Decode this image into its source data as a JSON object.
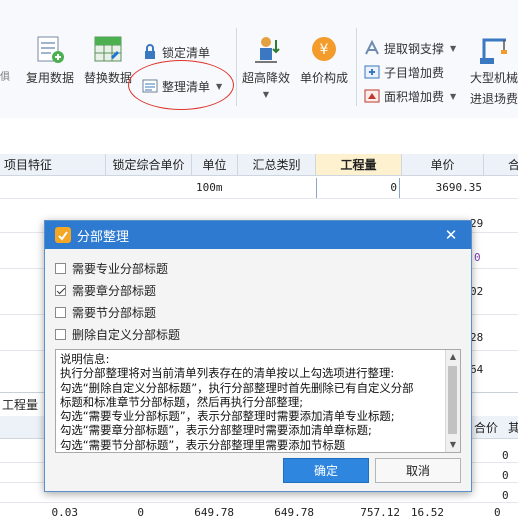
{
  "ribbon": {
    "reuse_label": "复用数据",
    "replace_label": "替换数据",
    "lock_label": "锁定清单",
    "organize_label": "整理清单",
    "height_reduce_label": "超高降效",
    "unit_price_label": "单价构成",
    "rebar_label": "提取钢支撑",
    "subitem_add_label": "子目增加费",
    "area_add_label": "面积增加费",
    "machinery_label_1": "大型机械",
    "machinery_label_2": "进退场费"
  },
  "table": {
    "headers": [
      "项目特征",
      "锁定综合单价",
      "单位",
      "汇总类别",
      "工程量",
      "单价",
      "合"
    ],
    "row1": {
      "unit": "100m",
      "qty": "0",
      "price": "3690.35"
    },
    "right_fragments": [
      "29",
      "0",
      "02",
      "28",
      "64"
    ],
    "lower_tab_label": "工程量",
    "lower_headers_fragment": [
      "合价",
      "其"
    ],
    "lower_zeros": [
      "0",
      "0",
      "0",
      "0"
    ],
    "bottom_row": [
      "0.03",
      "0",
      "649.78",
      "649.78",
      "757.12",
      "16.52",
      "0"
    ]
  },
  "dialog": {
    "title": "分部整理",
    "options": [
      {
        "label": "需要专业分部标题",
        "checked": false
      },
      {
        "label": "需要章分部标题",
        "checked": true
      },
      {
        "label": "需要节分部标题",
        "checked": false
      },
      {
        "label": "删除自定义分部标题",
        "checked": false
      }
    ],
    "info_lines": [
      "说明信息:",
      "执行分部整理将对当前清单列表存在的清单按以上勾选项进行整理:",
      "勾选“删除自定义分部标题”，执行分部整理时首先删除已有自定义分部",
      "标题和标准章节分部标题，然后再执行分部整理;",
      "勾选“需要专业分部标题”，表示分部整理时需要添加清单专业标题;",
      "勾选“需要章分部标题”，表示分部整理时需要添加清单章标题;",
      "勾选“需要节分部标题”，表示分部整理里需要添加节标题"
    ],
    "ok_label": "确定",
    "cancel_label": "取消"
  },
  "colors": {
    "title_bar": "#2e7ad1",
    "ok_button": "#2e86de",
    "highlight_ellipse": "#e0342c",
    "highlight_header": "#fdf1cf"
  }
}
